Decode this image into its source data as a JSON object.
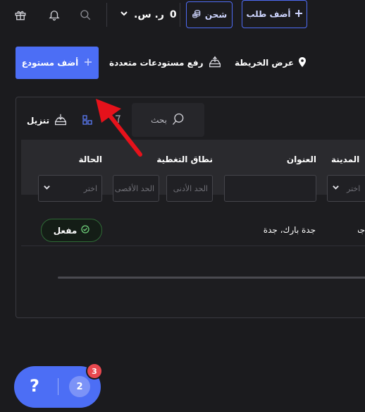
{
  "topbar": {
    "balance_amount": "0",
    "balance_currency": "ر. س.",
    "recharge_label": "شحن",
    "add_order_label": "أضف طلب"
  },
  "actions": {
    "map_view_label": "عرض الخريطة",
    "bulk_upload_label": "رفع مستودعات متعددة",
    "add_warehouse_label": "أضف مستودع"
  },
  "toolbar": {
    "search_placeholder": "بحث",
    "download_label": "تنزيل"
  },
  "table": {
    "columns": {
      "city": "المدينة",
      "address": "العنوان",
      "coverage": "نطاق التغطية",
      "status": "الحالة"
    },
    "filters": {
      "city_select": "اختر",
      "coverage_min": "الحد الأدنى",
      "coverage_max": "الحد الأقصى",
      "status_select": "اختر"
    },
    "rows": [
      {
        "city": "جدة",
        "address": "جدة بارك، جدة",
        "status": "مفعل"
      }
    ]
  },
  "help_widget": {
    "question_mark": "?",
    "count": "2",
    "badge": "3"
  },
  "colors": {
    "accent": "#4c6ef5",
    "background": "#1b1b1e",
    "arrow": "#e6121b",
    "active_green": "#2f6a36"
  }
}
